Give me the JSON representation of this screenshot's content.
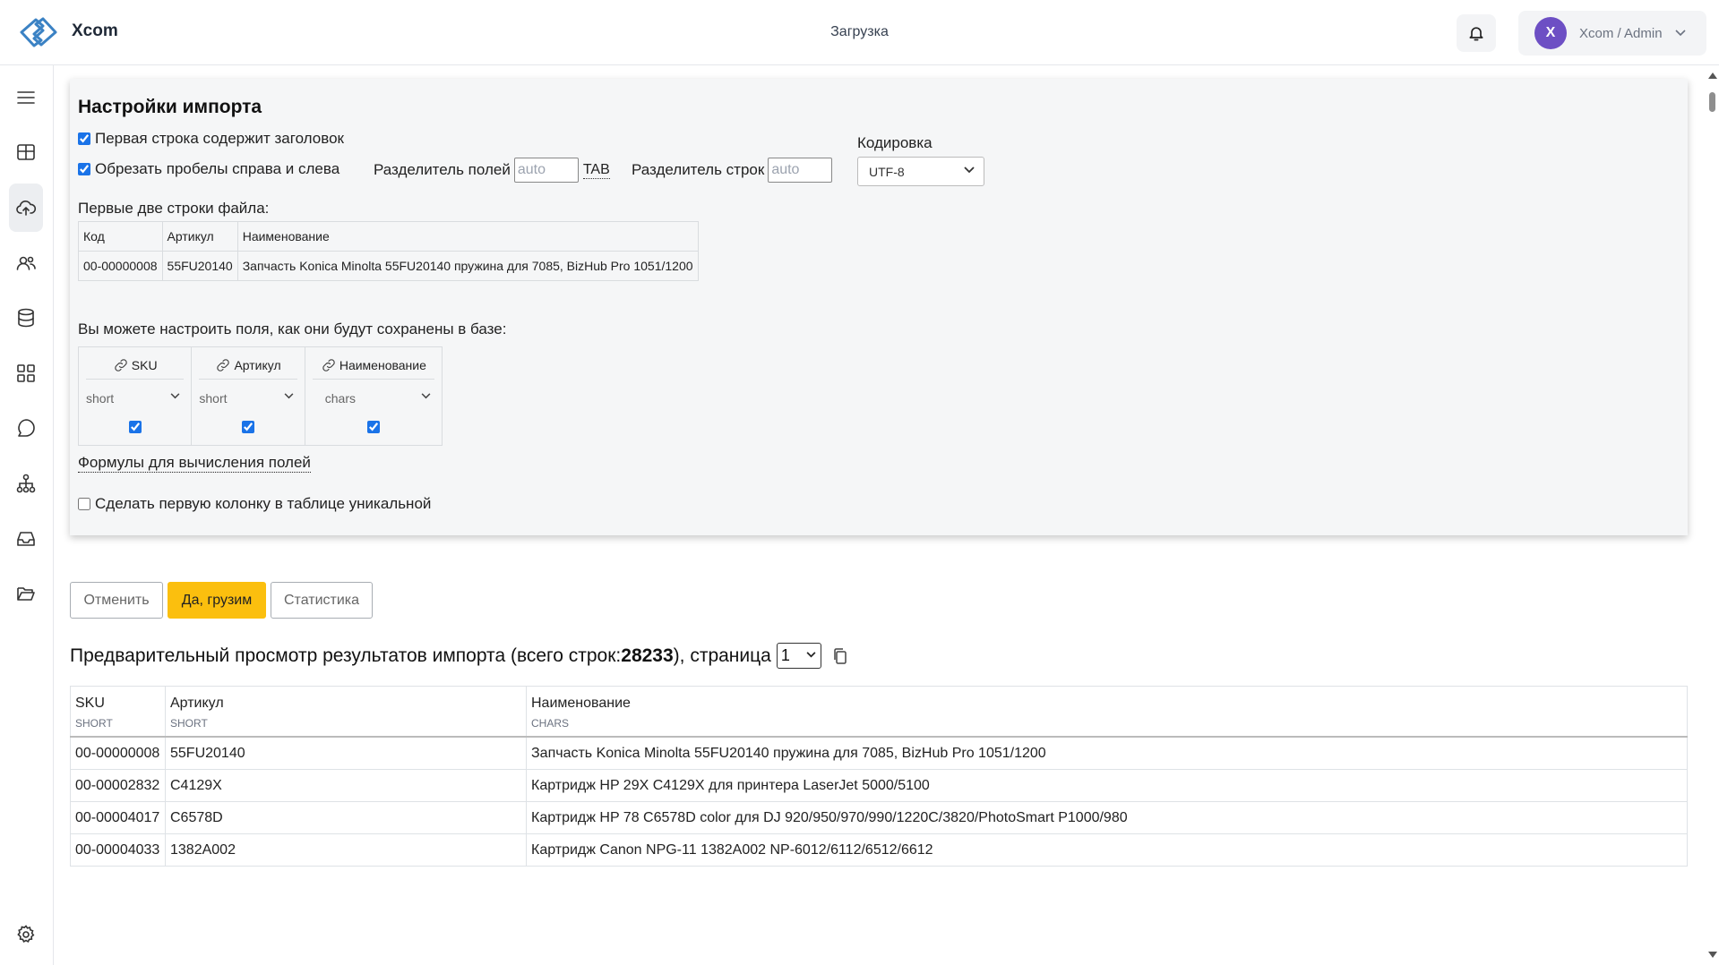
{
  "app": {
    "brand": "Xcom",
    "page_title": "Загрузка"
  },
  "user": {
    "initial": "X",
    "name": "Xcom / Admin"
  },
  "colors": {
    "accent": "#fbbf0e",
    "avatar": "#6d4fc4",
    "panel": "#f5f6f7"
  },
  "sidebar": {
    "items": [
      {
        "icon": "menu-icon"
      },
      {
        "icon": "dashboard-icon"
      },
      {
        "icon": "upload-cloud-icon",
        "active": true
      },
      {
        "icon": "users-icon"
      },
      {
        "icon": "database-icon"
      },
      {
        "icon": "apps-icon"
      },
      {
        "icon": "chat-icon"
      },
      {
        "icon": "hierarchy-icon"
      },
      {
        "icon": "inbox-icon"
      },
      {
        "icon": "folder-icon"
      },
      {
        "icon": "gear-icon"
      }
    ]
  },
  "settings": {
    "title": "Настройки импорта",
    "first_row_header": {
      "label": "Первая строка содержит заголовок",
      "checked": true
    },
    "trim_spaces": {
      "label": "Обрезать пробелы справа и слева",
      "checked": true
    },
    "field_separator": {
      "label": "Разделитель полей",
      "placeholder": "auto",
      "hint": "TAB"
    },
    "row_separator": {
      "label": "Разделитель строк",
      "placeholder": "auto"
    },
    "encoding": {
      "label": "Кодировка",
      "value": "UTF-8"
    },
    "sample_label": "Первые две строки файла:",
    "sample_rows": [
      [
        "Код",
        "Артикул",
        "Наименование"
      ],
      [
        "00-00000008",
        "55FU20140",
        "Запчасть Konica Minolta 55FU20140 пружина для 7085, BizHub Pro 1051/1200"
      ]
    ],
    "mapping_label": "Вы можете настроить поля, как они будут сохранены в базе:",
    "mapping": [
      {
        "name": "SKU",
        "type": "short",
        "checked": true
      },
      {
        "name": "Артикул",
        "type": "short",
        "checked": true
      },
      {
        "name": "Наименование",
        "type": "chars",
        "checked": true
      }
    ],
    "formulas_link": "Формулы для вычисления полей",
    "unique_first_col": {
      "label": "Сделать первую колонку в таблице уникальной",
      "checked": false
    }
  },
  "actions": {
    "cancel": "Отменить",
    "confirm": "Да, грузим",
    "stats": "Статистика"
  },
  "preview": {
    "title_prefix": "Предварительный просмотр результатов импорта (всего строк: ",
    "total_rows": "28233",
    "title_suffix": "), страница",
    "page": "1",
    "columns": [
      {
        "name": "SKU",
        "type": "SHORT"
      },
      {
        "name": "Артикул",
        "type": "SHORT"
      },
      {
        "name": "Наименование",
        "type": "CHARS"
      }
    ],
    "rows": [
      [
        "00-00000008",
        "55FU20140",
        "Запчасть Konica Minolta 55FU20140 пружина для 7085, BizHub Pro 1051/1200"
      ],
      [
        "00-00002832",
        "C4129X",
        "Картридж HP 29X C4129X для принтера LaserJet 5000/5100"
      ],
      [
        "00-00004017",
        "C6578D",
        "Картридж HP 78 C6578D color для DJ 920/950/970/990/1220C/3820/PhotoSmart P1000/980"
      ],
      [
        "00-00004033",
        "1382A002",
        "Картридж Canon NPG-11 1382A002 NP-6012/6112/6512/6612"
      ]
    ]
  }
}
